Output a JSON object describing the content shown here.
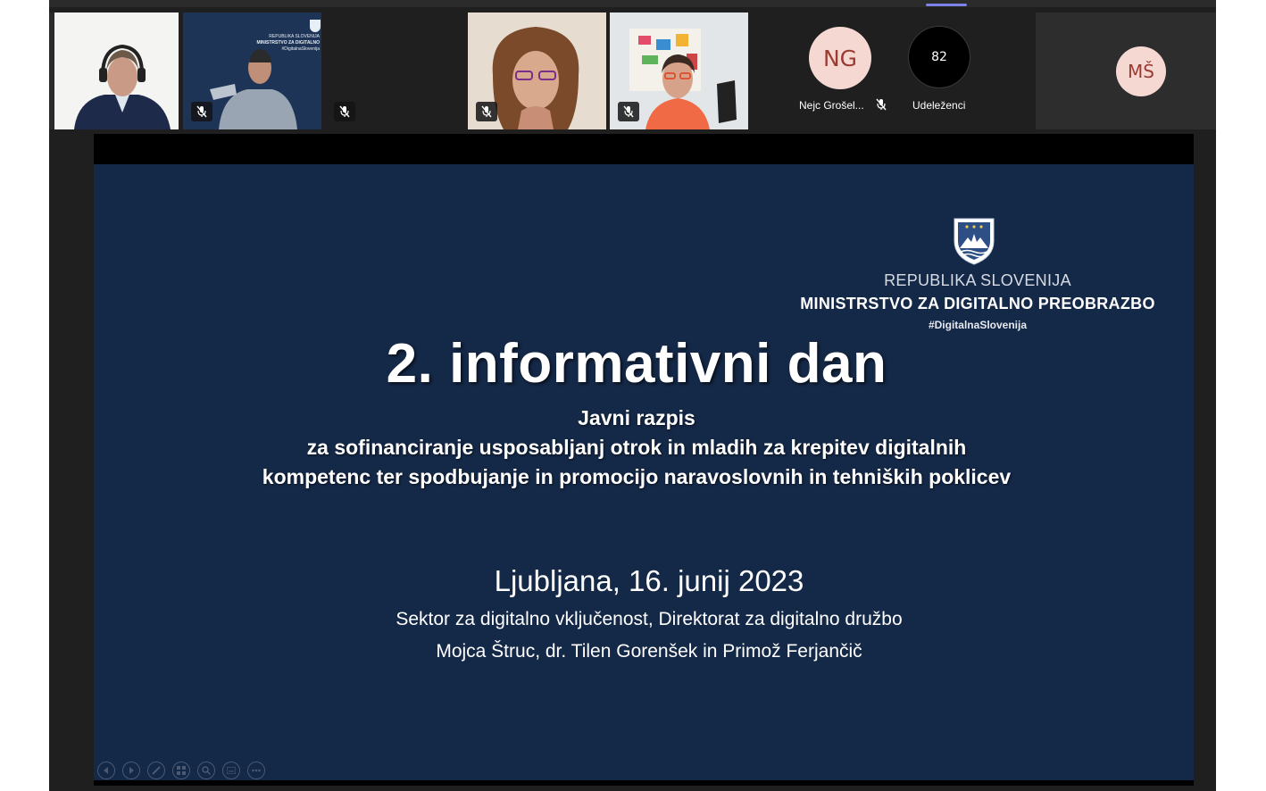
{
  "participants": {
    "ng": {
      "initials": "NG",
      "name": "Nejc Grošel..."
    },
    "count": {
      "value": "82",
      "label": "Udeleženci"
    },
    "ms": {
      "initials": "MŠ"
    },
    "tile2_logo": [
      "REPUBLIKA SLOVENIJA",
      "MINISTRSTVO ZA DIGITALNO",
      "#DigitalnaSlovenija"
    ]
  },
  "slide": {
    "logo": {
      "line1": "REPUBLIKA SLOVENIJA",
      "line2": "MINISTRSTVO ZA DIGITALNO PREOBRAZBO",
      "line3": "#DigitalnaSlovenija"
    },
    "title": "2. informativni dan",
    "subtitle_lines": [
      "Javni razpis",
      "za sofinanciranje usposabljanj otrok in mladih za krepitev digitalnih",
      "kompetenc ter spodbujanje in promocijo naravoslovnih in tehniških poklicev"
    ],
    "date": "Ljubljana, 16. junij 2023",
    "dept": "Sektor za digitalno vključenost, Direktorat za digitalno družbo",
    "authors": "Mojca Štruc, dr. Tilen Gorenšek in Primož Ferjančič"
  },
  "icons": {
    "mic_off": "mic-off-icon",
    "controls": [
      "previous-slide-icon",
      "next-slide-icon",
      "pen-icon",
      "slides-grid-icon",
      "zoom-icon",
      "subtitles-icon",
      "more-icon"
    ]
  },
  "colors": {
    "slide_bg": "#142847",
    "active_border": "#7b83eb",
    "avatar_bg": "#f6d8d2",
    "avatar_text": "#9b3a32"
  }
}
